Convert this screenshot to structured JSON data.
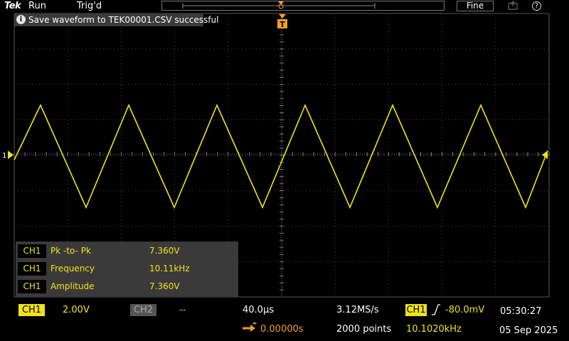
{
  "topbar": {
    "brand": "Tek",
    "run_state": "Run",
    "trigger_state": "Trig'd",
    "fine_label": "Fine",
    "help_label": "?"
  },
  "notification": {
    "icon": "info-icon",
    "icon_label": "i",
    "text": "Save waveform to TEK00001.CSV successful"
  },
  "channel_marker": {
    "label": "1"
  },
  "measurements": [
    {
      "channel": "CH1",
      "name": "Pk -to- Pk",
      "value": "7.360V"
    },
    {
      "channel": "CH1",
      "name": "Frequency",
      "value": "10.11kHz"
    },
    {
      "channel": "CH1",
      "name": "Amplitude",
      "value": "7.360V"
    }
  ],
  "bottombar": {
    "ch1_label": "CH1",
    "ch1_scale": "2.00V",
    "ch2_label": "CH2",
    "ch2_scale": "--",
    "timebase": "40.0µs",
    "sample_rate": "3.12MS/s",
    "trigger_source": "CH1",
    "trigger_level": "-80.0mV",
    "time": "05:30:27",
    "horizontal_position": "0.00000s",
    "record_length": "2000 points",
    "trigger_frequency": "10.1020kHz",
    "date": "05 Sep 2025"
  },
  "colors": {
    "ch1": "#f2e21a",
    "trigger_marker": "#f2a020",
    "background": "#000000",
    "grid": "#555555"
  }
}
